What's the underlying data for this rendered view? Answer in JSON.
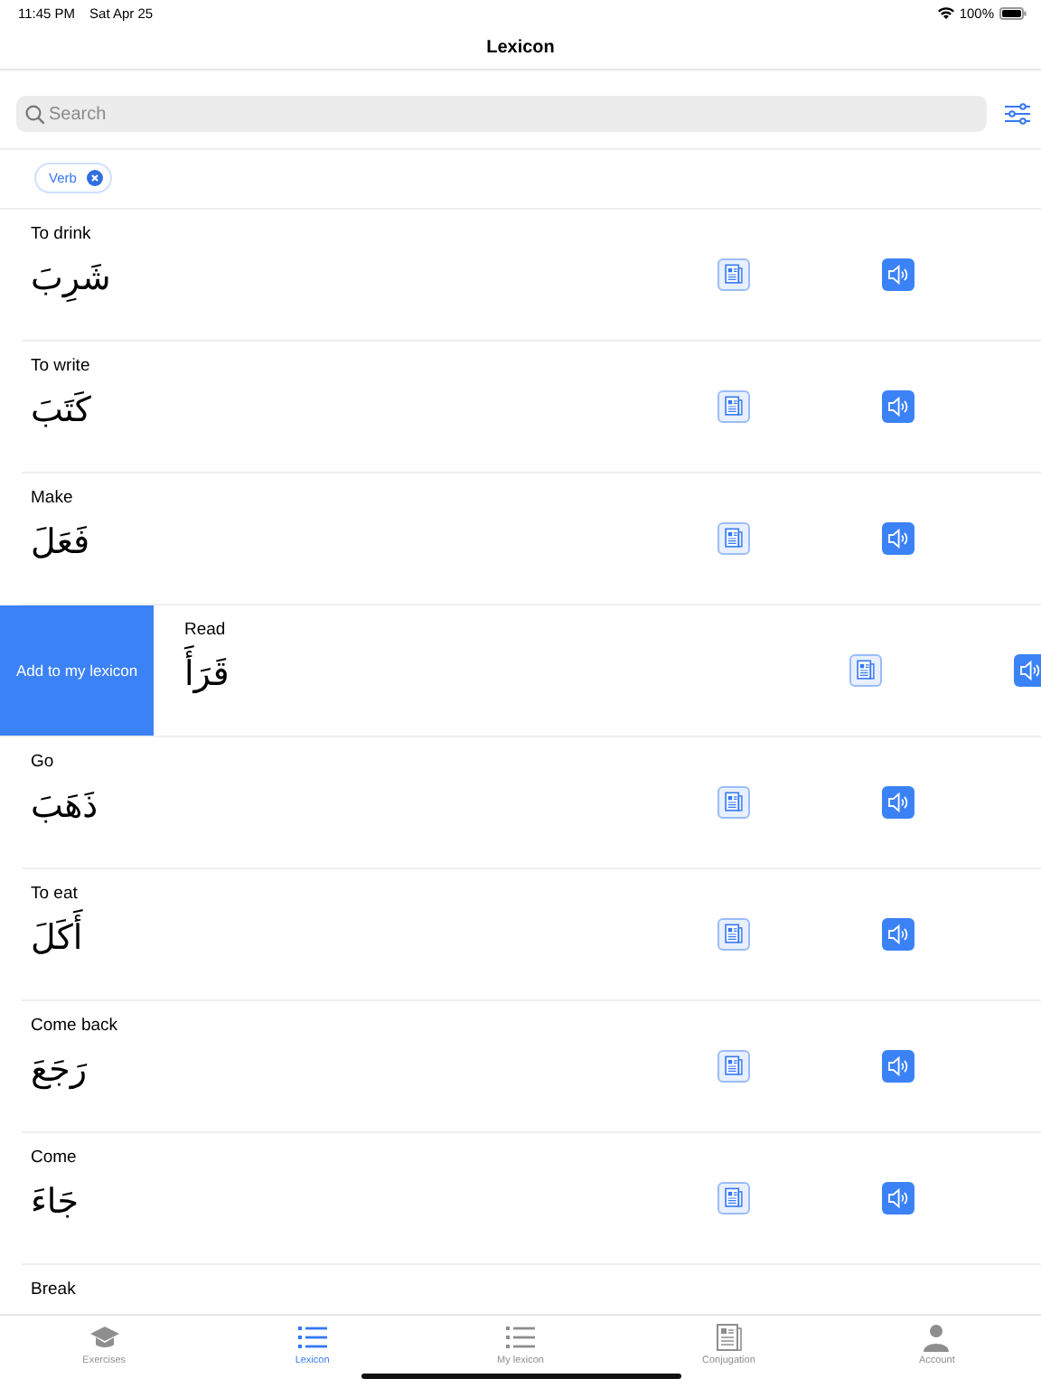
{
  "status_bar": {
    "time": "11:45 PM",
    "date": "Sat Apr 25",
    "battery": "100%"
  },
  "nav": {
    "title": "Lexicon"
  },
  "search": {
    "placeholder": "Search"
  },
  "filters": [
    {
      "label": "Verb"
    }
  ],
  "words": [
    {
      "english": "To drink",
      "arabic": "شَرِبَ",
      "swiped": false
    },
    {
      "english": "To write",
      "arabic": "كَتَبَ",
      "swiped": false
    },
    {
      "english": "Make",
      "arabic": "فَعَلَ",
      "swiped": false
    },
    {
      "english": "Read",
      "arabic": "قَرَأَ",
      "swiped": true,
      "action": "Add to my lexicon"
    },
    {
      "english": "Go",
      "arabic": "ذَهَبَ",
      "swiped": false
    },
    {
      "english": "To eat",
      "arabic": "أَكَلَ",
      "swiped": false
    },
    {
      "english": "Come back",
      "arabic": "رَجَعَ",
      "swiped": false
    },
    {
      "english": "Come",
      "arabic": "جَاءَ",
      "swiped": false
    },
    {
      "english": "Break",
      "swiped": false
    }
  ],
  "tabs": [
    {
      "kind": "exercises",
      "label": "Exercises",
      "selected": false
    },
    {
      "kind": "lexicon",
      "label": "Lexicon",
      "selected": true
    },
    {
      "kind": "mylexicon",
      "label": "My lexicon",
      "selected": false
    },
    {
      "kind": "conjugation",
      "label": "Conjugation",
      "selected": false
    },
    {
      "kind": "account",
      "label": "Account",
      "selected": false
    }
  ]
}
